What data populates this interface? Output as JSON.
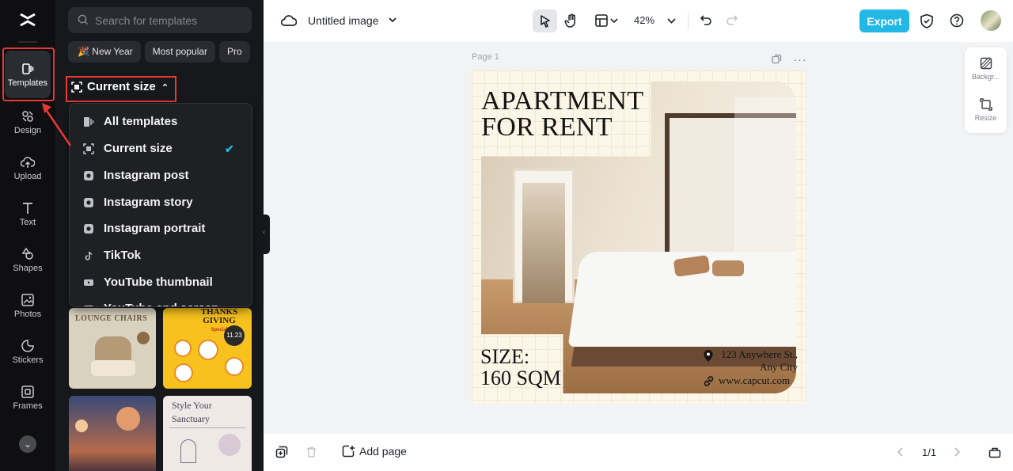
{
  "rail": {
    "items": [
      {
        "label": "Templates"
      },
      {
        "label": "Design"
      },
      {
        "label": "Upload"
      },
      {
        "label": "Text"
      },
      {
        "label": "Shapes"
      },
      {
        "label": "Photos"
      },
      {
        "label": "Stickers"
      },
      {
        "label": "Frames"
      }
    ]
  },
  "panel": {
    "search_placeholder": "Search for templates",
    "chips": [
      "🎉 New Year",
      "Most popular",
      "Pro"
    ],
    "size_filter": "Current size",
    "dropdown": [
      {
        "label": "All templates",
        "selected": false
      },
      {
        "label": "Current size",
        "selected": true
      },
      {
        "label": "Instagram post",
        "selected": false
      },
      {
        "label": "Instagram story",
        "selected": false
      },
      {
        "label": "Instagram portrait",
        "selected": false
      },
      {
        "label": "TikTok",
        "selected": false
      },
      {
        "label": "YouTube thumbnail",
        "selected": false
      },
      {
        "label": "YouTube end screen",
        "selected": false
      }
    ],
    "templates": [
      {
        "text": "LOUNGE CHAIRS"
      },
      {
        "text": "THANKS GIVING",
        "subtext": "Special",
        "date": "11.23"
      },
      {
        "text": ""
      },
      {
        "text": "Style Your Sanctuary"
      }
    ]
  },
  "topbar": {
    "title": "Untitled image",
    "zoom": "42%",
    "export_label": "Export"
  },
  "canvas": {
    "page_label": "Page 1",
    "headline": "APARTMENT\nFOR RENT",
    "size_line1": "SIZE:",
    "size_line2": "160 SQM",
    "address": "123 Anywhere St.,\nAny City",
    "website": "www.capcut.com"
  },
  "right_tools": [
    {
      "label": "Backgr..."
    },
    {
      "label": "Resize"
    }
  ],
  "bottombar": {
    "add_page_label": "Add page",
    "page_counter": "1/1"
  },
  "colors": {
    "accent": "#22b8e6",
    "highlight": "#e53935",
    "panel_bg": "#17181c",
    "rail_bg": "#0f0f12",
    "artboard_bg": "#fbf6e7"
  }
}
